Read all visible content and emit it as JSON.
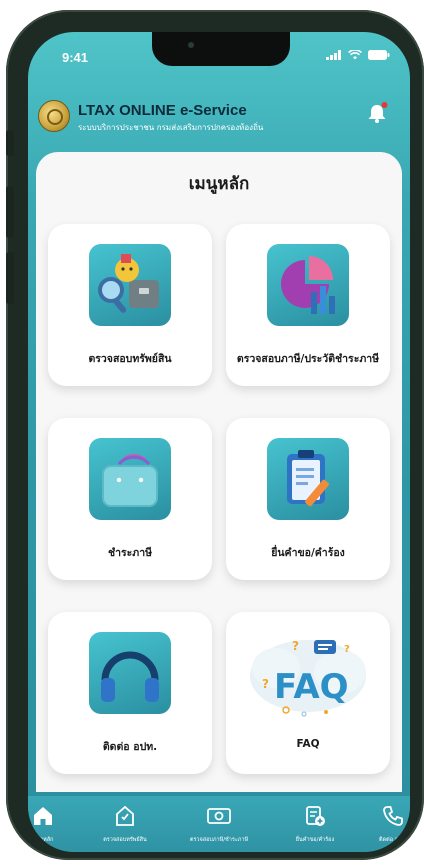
{
  "status_bar": {
    "time": "9:41"
  },
  "header": {
    "title": "LTAX ONLINE e-Service",
    "subtitle": "ระบบบริการประชาชน กรมส่งเสริมการปกครองท้องถิ่น"
  },
  "menu": {
    "title": "เมนูหลัก",
    "items": [
      {
        "label": "ตรวจสอบทรัพย์สิน",
        "icon": "property-search-icon"
      },
      {
        "label": "ตรวจสอบภาษี/ประวัติชำระภาษี",
        "icon": "tax-history-chart-icon"
      },
      {
        "label": "ชำระภาษี",
        "icon": "payment-bag-icon"
      },
      {
        "label": "ยื่นคำขอ/คำร้อง",
        "icon": "request-clipboard-icon"
      },
      {
        "label": "ติดต่อ อปท.",
        "icon": "headphones-icon"
      },
      {
        "label": "FAQ",
        "icon": "faq-icon",
        "faq_text": "FAQ"
      }
    ]
  },
  "bottom_nav": [
    {
      "label": "หน้าหลัก",
      "icon": "home-icon"
    },
    {
      "label": "ตรวจสอบทรัพย์สิน",
      "icon": "property-icon"
    },
    {
      "label": "ตรวจสอบภาษี/ชำระภาษี",
      "icon": "money-icon"
    },
    {
      "label": "ยื่นคำขอ/คำร้อง",
      "icon": "document-add-icon"
    },
    {
      "label": "ติดต่อ อปท.",
      "icon": "phone-icon"
    }
  ],
  "colors": {
    "accent": "#2e97a6",
    "header_gradient_top": "#4fc4c8",
    "title_text": "#0d2b3a",
    "notification_dot": "#e53935"
  }
}
